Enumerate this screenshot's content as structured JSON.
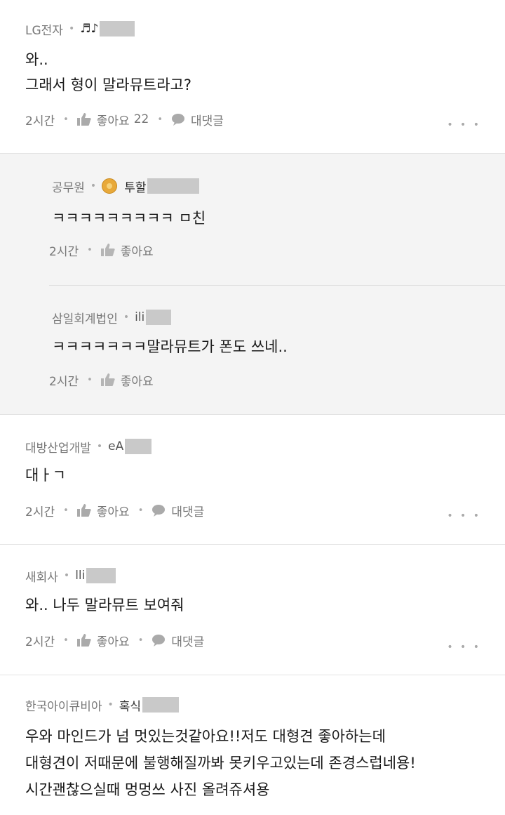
{
  "comments": [
    {
      "company": "LG전자",
      "nick": "♬♪",
      "body": [
        "와..",
        "그래서 형이 말라뮤트라고?"
      ],
      "time": "2시간",
      "like_label": "좋아요",
      "like_count": "22",
      "reply_label": "대댓글",
      "more": "• • •",
      "replies": [
        {
          "company": "공무원",
          "nick": "투할",
          "body": [
            "ㅋㅋㅋㅋㅋㅋㅋㅋㅋ ㅁ친"
          ],
          "time": "2시간",
          "like_label": "좋아요"
        },
        {
          "company": "삼일회계법인",
          "nick": "ili",
          "body": [
            "ㅋㅋㅋㅋㅋㅋㅋ말라뮤트가 폰도 쓰네.."
          ],
          "time": "2시간",
          "like_label": "좋아요"
        }
      ]
    },
    {
      "company": "대방산업개발",
      "nick": "eA",
      "body": [
        "대ㅏㄱ"
      ],
      "time": "2시간",
      "like_label": "좋아요",
      "reply_label": "대댓글",
      "more": "• • •"
    },
    {
      "company": "새회사",
      "nick": "lli",
      "body": [
        "와.. 나두 말라뮤트 보여줘"
      ],
      "time": "2시간",
      "like_label": "좋아요",
      "reply_label": "대댓글",
      "more": "• • •"
    },
    {
      "company": "한국아이큐비아",
      "nick": "혹식",
      "body": [
        "우와 마인드가 넘 멋있는것같아요!!저도 대형견 좋아하는데",
        "대형견이 저때문에 불행해질까봐 못키우고있는데 존경스럽네용!",
        "시간괜찮으실때 멍멍쓰 사진 올려쥬셔용"
      ]
    }
  ],
  "separator": "•",
  "icons": {
    "like": "thumbs-up-icon",
    "reply": "speech-bubble-icon",
    "badge": "gold-badge-icon",
    "more": "more-dots-icon"
  },
  "colors": {
    "meta": "#777777",
    "reply_bg": "#f4f4f4",
    "divider": "#e3e3e3",
    "blur": "#c9c9c9"
  }
}
